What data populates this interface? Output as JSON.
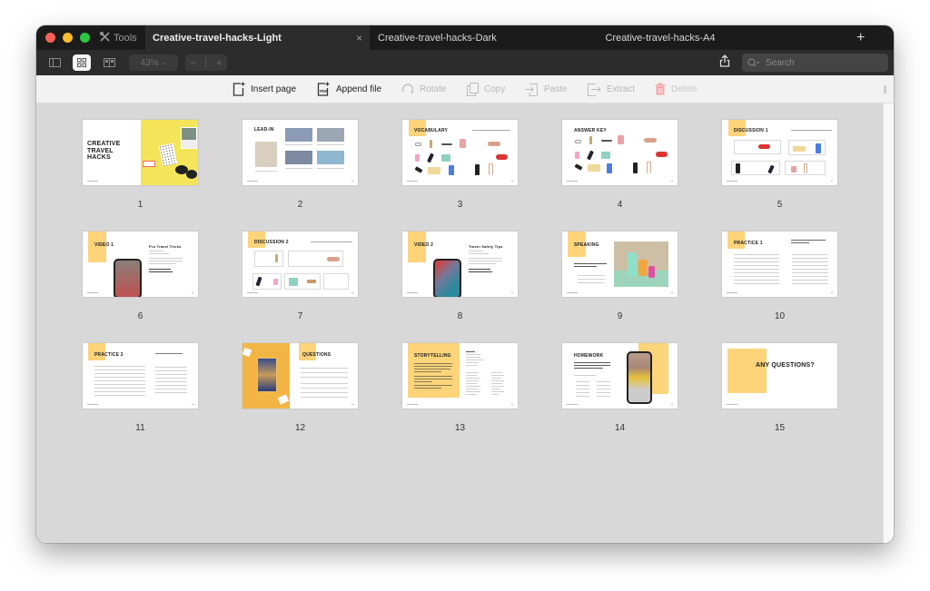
{
  "window": {
    "traffic_lights": [
      "close",
      "minimize",
      "zoom"
    ],
    "tools_label": "Tools",
    "tabs": [
      {
        "label": "Creative-travel-hacks-Light",
        "active": true,
        "close_glyph": "×"
      },
      {
        "label": "Creative-travel-hacks-Dark",
        "active": false
      },
      {
        "label": "Creative-travel-hacks-A4",
        "active": false
      }
    ],
    "new_tab_glyph": "+"
  },
  "toolbar": {
    "view_modes": [
      "sidebar-view",
      "grid-view",
      "two-page-view"
    ],
    "selected_view": "grid-view",
    "zoom_level": "43%",
    "zoom_out": "−",
    "zoom_in": "+",
    "search_placeholder": "Search"
  },
  "actions": [
    {
      "label": "Insert page",
      "icon": "insert-page-icon",
      "enabled": true
    },
    {
      "label": "Append file",
      "icon": "append-pdf-icon",
      "enabled": true
    },
    {
      "label": "Rotate",
      "icon": "rotate-icon",
      "enabled": false
    },
    {
      "label": "Copy",
      "icon": "copy-icon",
      "enabled": false
    },
    {
      "label": "Paste",
      "icon": "paste-icon",
      "enabled": false
    },
    {
      "label": "Extract",
      "icon": "extract-icon",
      "enabled": false
    },
    {
      "label": "Delete",
      "icon": "trash-icon",
      "enabled": false
    }
  ],
  "accent_colors": {
    "slide_yellow": "#fdd47a",
    "delete_red": "#f2a5a5"
  },
  "pages": [
    {
      "number": "1",
      "title": "CREATIVE TRAVEL HACKS"
    },
    {
      "number": "2",
      "title": "LEAD-IN"
    },
    {
      "number": "3",
      "title": "VOCABULARY"
    },
    {
      "number": "4",
      "title": "ANSWER KEY"
    },
    {
      "number": "5",
      "title": "DISCUSSION 1"
    },
    {
      "number": "6",
      "title": "VIDEO 1",
      "subtitle": "Pro Travel Tricks"
    },
    {
      "number": "7",
      "title": "DISCUSSION 2"
    },
    {
      "number": "8",
      "title": "VIDEO 2",
      "subtitle": "Travel Safety Tips"
    },
    {
      "number": "9",
      "title": "SPEAKING"
    },
    {
      "number": "10",
      "title": "PRACTICE 1"
    },
    {
      "number": "11",
      "title": "PRACTICE 2"
    },
    {
      "number": "12",
      "title": "QUESTIONS"
    },
    {
      "number": "13",
      "title": "STORYTELLING"
    },
    {
      "number": "14",
      "title": "HOMEWORK"
    },
    {
      "number": "15",
      "title": "ANY QUESTIONS?"
    }
  ]
}
